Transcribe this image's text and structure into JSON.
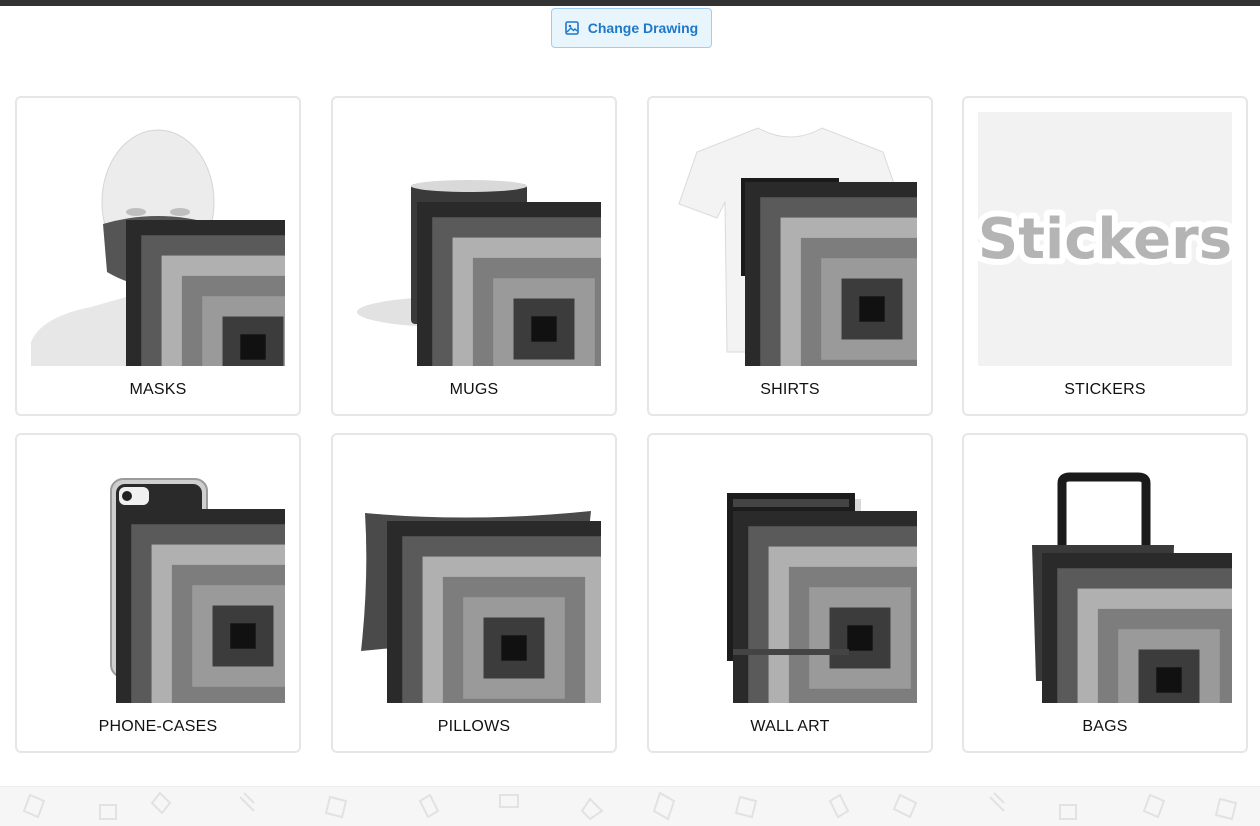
{
  "toolbar": {
    "change_drawing_label": "Change Drawing",
    "icon": "image-icon"
  },
  "products": [
    {
      "label": "MASKS",
      "icon": "mask-image"
    },
    {
      "label": "MUGS",
      "icon": "mug-image"
    },
    {
      "label": "SHIRTS",
      "icon": "shirt-image"
    },
    {
      "label": "STICKERS",
      "icon": "stickers-image",
      "image_text": "Stickers"
    },
    {
      "label": "PHONE-CASES",
      "icon": "phone-case-image"
    },
    {
      "label": "PILLOWS",
      "icon": "pillow-image"
    },
    {
      "label": "WALL ART",
      "icon": "wall-art-image"
    },
    {
      "label": "BAGS",
      "icon": "bag-image"
    }
  ],
  "colors": {
    "accent": "#1e78c8",
    "button_bg": "#e9f5fd",
    "card_border": "#e6e6e6"
  }
}
